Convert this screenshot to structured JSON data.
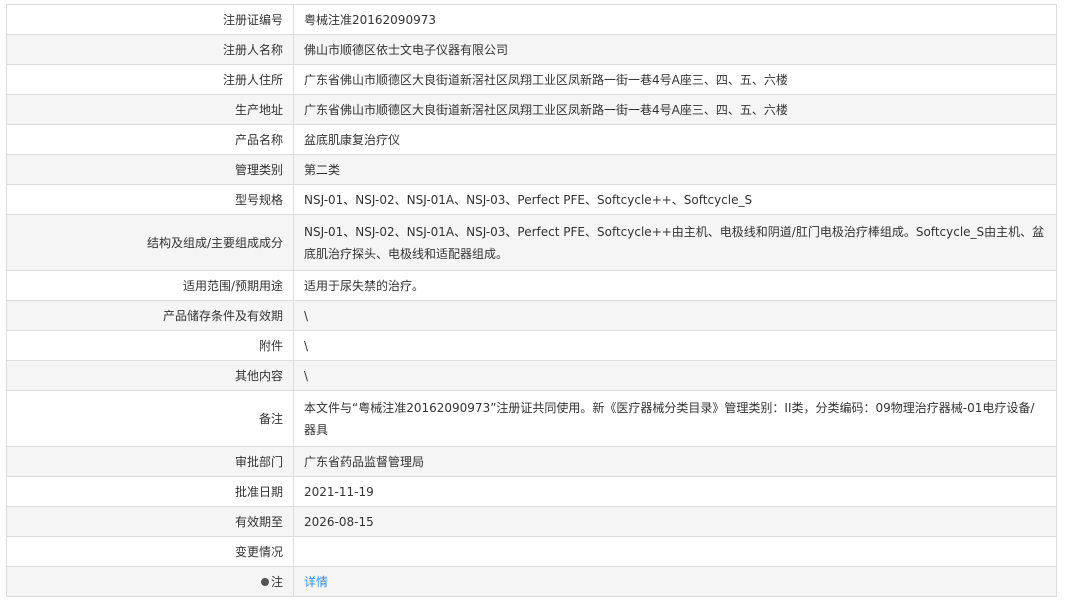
{
  "rows": [
    {
      "label": "注册证编号",
      "value": "粤械注准20162090973"
    },
    {
      "label": "注册人名称",
      "value": "佛山市顺德区依士文电子仪器有限公司"
    },
    {
      "label": "注册人住所",
      "value": "广东省佛山市顺德区大良街道新滘社区凤翔工业区凤新路一街一巷4号A座三、四、五、六楼"
    },
    {
      "label": "生产地址",
      "value": "广东省佛山市顺德区大良街道新滘社区凤翔工业区凤新路一街一巷4号A座三、四、五、六楼"
    },
    {
      "label": "产品名称",
      "value": "盆底肌康复治疗仪"
    },
    {
      "label": "管理类别",
      "value": "第二类"
    },
    {
      "label": "型号规格",
      "value": "NSJ-01、NSJ-02、NSJ-01A、NSJ-03、Perfect PFE、Softcycle++、Softcycle_S"
    },
    {
      "label": "结构及组成/主要组成成分",
      "value": "NSJ-01、NSJ-02、NSJ-01A、NSJ-03、Perfect PFE、Softcycle++由主机、电极线和阴道/肛门电极治疗棒组成。Softcycle_S由主机、盆底肌治疗探头、电极线和适配器组成。"
    },
    {
      "label": "适用范围/预期用途",
      "value": "适用于尿失禁的治疗。"
    },
    {
      "label": "产品储存条件及有效期",
      "value": "\\"
    },
    {
      "label": "附件",
      "value": "\\"
    },
    {
      "label": "其他内容",
      "value": "\\"
    },
    {
      "label": "备注",
      "value": "本文件与“粤械注准20162090973”注册证共同使用。新《医疗器械分类目录》管理类别：II类，分类编码：09物理治疗器械-01电疗设备/器具"
    },
    {
      "label": "审批部门",
      "value": "广东省药品监督管理局"
    },
    {
      "label": "批准日期",
      "value": "2021-11-19"
    },
    {
      "label": "有效期至",
      "value": "2026-08-15"
    },
    {
      "label": "变更情况",
      "value": ""
    }
  ],
  "note": {
    "label": "注",
    "link": "详情"
  }
}
